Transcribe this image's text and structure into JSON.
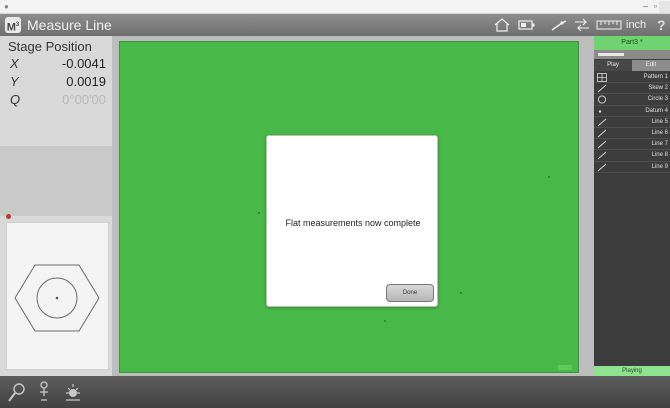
{
  "header": {
    "logo_letter": "M",
    "logo_sup": "3",
    "title": "Measure Line",
    "unit": "inch",
    "help": "?"
  },
  "stage": {
    "title": "Stage Position",
    "axes": [
      {
        "label": "X",
        "value": "-0.0041"
      },
      {
        "label": "Y",
        "value": "0.0019"
      },
      {
        "label": "Q",
        "value": "0°00'00"
      }
    ]
  },
  "dialog": {
    "message": "Flat measurements now complete",
    "done_label": "Done"
  },
  "right_panel": {
    "part_name": "Part3 *",
    "tabs": [
      "Play",
      "Edit"
    ],
    "features": [
      {
        "icon": "pattern-icon",
        "label": "Pattern 1"
      },
      {
        "icon": "line-icon",
        "label": "Skew 2"
      },
      {
        "icon": "circle-icon",
        "label": "Circle 3"
      },
      {
        "icon": "point-icon",
        "label": "Datum 4"
      },
      {
        "icon": "line-icon",
        "label": "Line 5"
      },
      {
        "icon": "line-icon",
        "label": "Line 6"
      },
      {
        "icon": "line-icon",
        "label": "Line 7"
      },
      {
        "icon": "line-icon",
        "label": "Line 8"
      },
      {
        "icon": "line-icon",
        "label": "Line 9"
      }
    ],
    "status": "Playing"
  },
  "colors": {
    "camera_green": "#48b948",
    "status_green": "#8fe28f",
    "header_grey": "#7e7e7e"
  }
}
